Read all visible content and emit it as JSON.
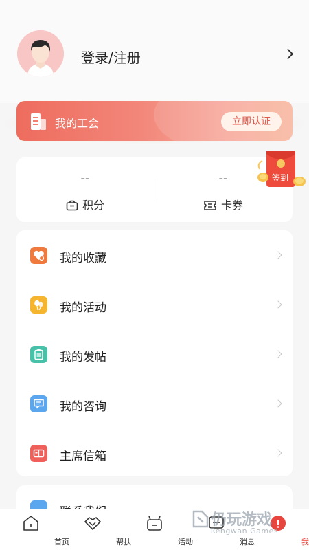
{
  "profile": {
    "login_label": "登录/注册"
  },
  "union": {
    "label": "我的工会",
    "verify_button": "立即认证"
  },
  "points": {
    "points_value": "--",
    "points_label": "积分",
    "coupons_value": "--",
    "coupons_label": "卡券"
  },
  "signin": {
    "label": "签到"
  },
  "menu": {
    "items": [
      {
        "label": "我的收藏",
        "icon": "heart-collection-icon",
        "color": "#f07a3e"
      },
      {
        "label": "我的活动",
        "icon": "balloon-activity-icon",
        "color": "#f5b52e"
      },
      {
        "label": "我的发帖",
        "icon": "clipboard-post-icon",
        "color": "#47c1a8"
      },
      {
        "label": "我的咨询",
        "icon": "chat-consult-icon",
        "color": "#5aa7ef"
      },
      {
        "label": "主席信箱",
        "icon": "mailbox-icon",
        "color": "#f0605a"
      }
    ]
  },
  "contact": {
    "label": "联系我们"
  },
  "tabbar": {
    "tabs": [
      {
        "label": "首页",
        "icon": "home-icon"
      },
      {
        "label": "帮扶",
        "icon": "handshake-icon"
      },
      {
        "label": "活动",
        "icon": "activity-icon"
      },
      {
        "label": "消息",
        "icon": "message-icon"
      },
      {
        "label": "我的",
        "icon": "profile-icon",
        "active": true
      }
    ]
  },
  "watermark": {
    "title": "仍玩游戏",
    "subtitle": "Rengwan Games"
  },
  "colors": {
    "accent": "#e7463f",
    "union_gradient_start": "#ee6c5e",
    "union_gradient_end": "#f7b79f"
  }
}
